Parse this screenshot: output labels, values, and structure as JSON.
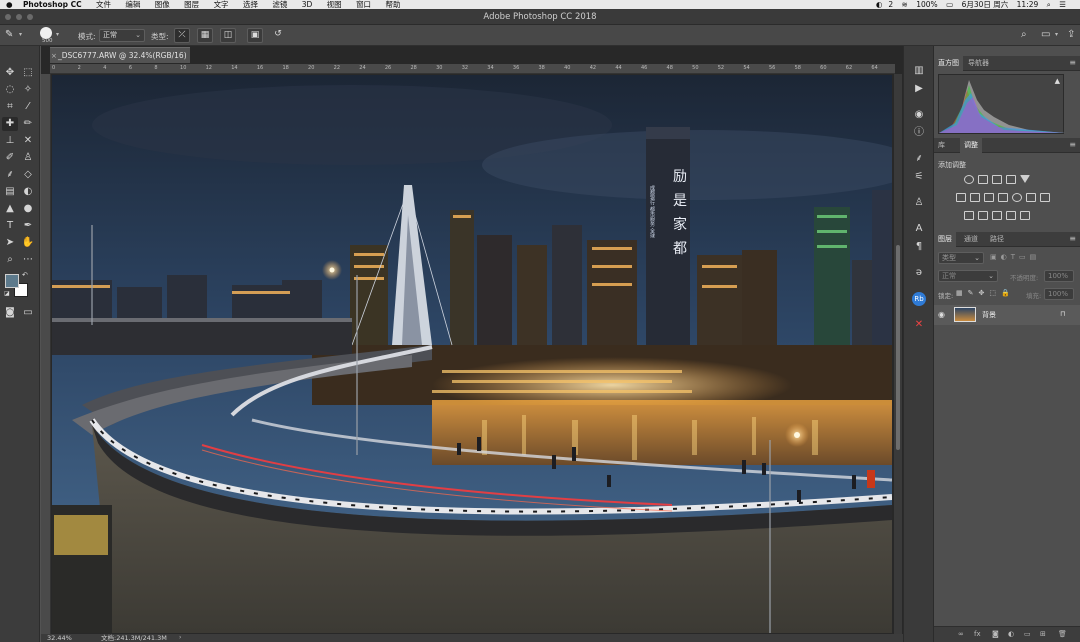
{
  "menubar": {
    "app_name": "Photoshop CC",
    "items": [
      "文件",
      "编辑",
      "图像",
      "图层",
      "文字",
      "选择",
      "滤镜",
      "3D",
      "视图",
      "窗口",
      "帮助"
    ],
    "status": {
      "notifications": "2",
      "battery": "100%",
      "date": "6月30日 周六",
      "time": "11:29"
    }
  },
  "window": {
    "title": "Adobe Photoshop CC 2018"
  },
  "options": {
    "brush_size": "500",
    "mode_label": "模式:",
    "mode_value": "正常",
    "type_label": "类型:"
  },
  "document": {
    "tab_title": "_DSC6777.ARW @ 32.4%(RGB/16)",
    "zoom": "32.44%",
    "doc_info": "文档:241.3M/241.3M",
    "ruler_labels": [
      "0",
      "2",
      "4",
      "6",
      "8",
      "10",
      "12",
      "14",
      "16",
      "18",
      "20",
      "22",
      "24",
      "26",
      "28",
      "30",
      "32",
      "34",
      "36",
      "38",
      "40",
      "42",
      "44",
      "46",
      "48",
      "50",
      "52",
      "54",
      "56",
      "58",
      "60",
      "62",
      "64"
    ]
  },
  "sign_text": [
    "励",
    "是",
    "家",
    "都"
  ],
  "sign_small": "成都银行 都市服务 全球",
  "panels": {
    "histogram_tabs": [
      "直方图",
      "导航器"
    ],
    "adjust_tabs": [
      "库",
      "调整"
    ],
    "adjust_title": "添加调整",
    "layers_tabs": [
      "图层",
      "通道",
      "路径"
    ],
    "layer_filter": "类型",
    "blend_mode": "正常",
    "opacity_label": "不透明度:",
    "opacity_value": "100%",
    "lock_label": "锁定:",
    "fill_label": "填充:",
    "fill_value": "100%",
    "layer_name": "背景"
  },
  "colors": {
    "ui_dark": "#3c3c3c",
    "ui_mid": "#535353",
    "panel": "#4f4f4f",
    "foreground": "#5d7a8c",
    "background": "#ffffff",
    "sky_top": "#1f2a3a",
    "sky_bottom": "#3a5a80"
  }
}
